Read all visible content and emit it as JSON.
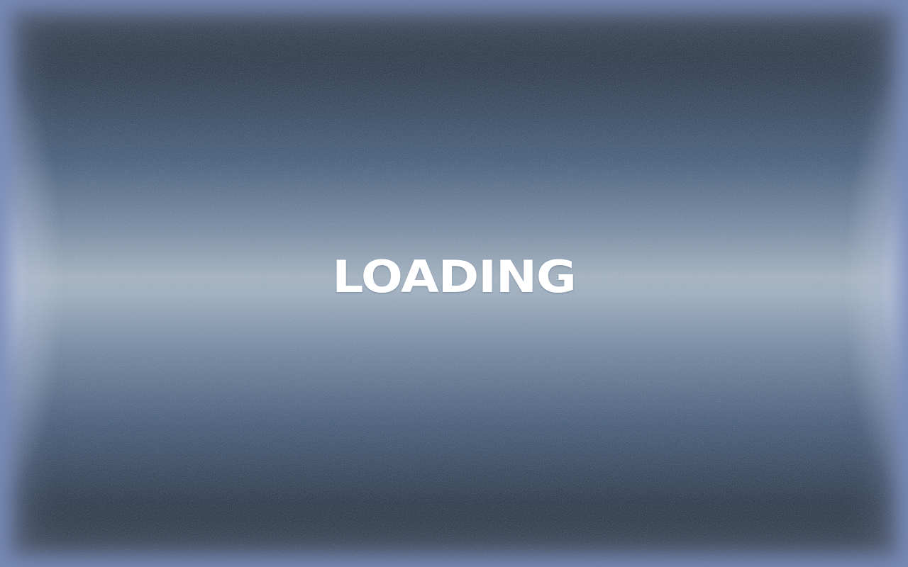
{
  "screen": {
    "loading_label": "LOADING"
  },
  "colors": {
    "text": "#ffffff",
    "background_dark": "#1b2633",
    "background_mid": "#3d5777",
    "background_light": "#a3b4c4",
    "edge_glow": "#8c9cc8"
  }
}
